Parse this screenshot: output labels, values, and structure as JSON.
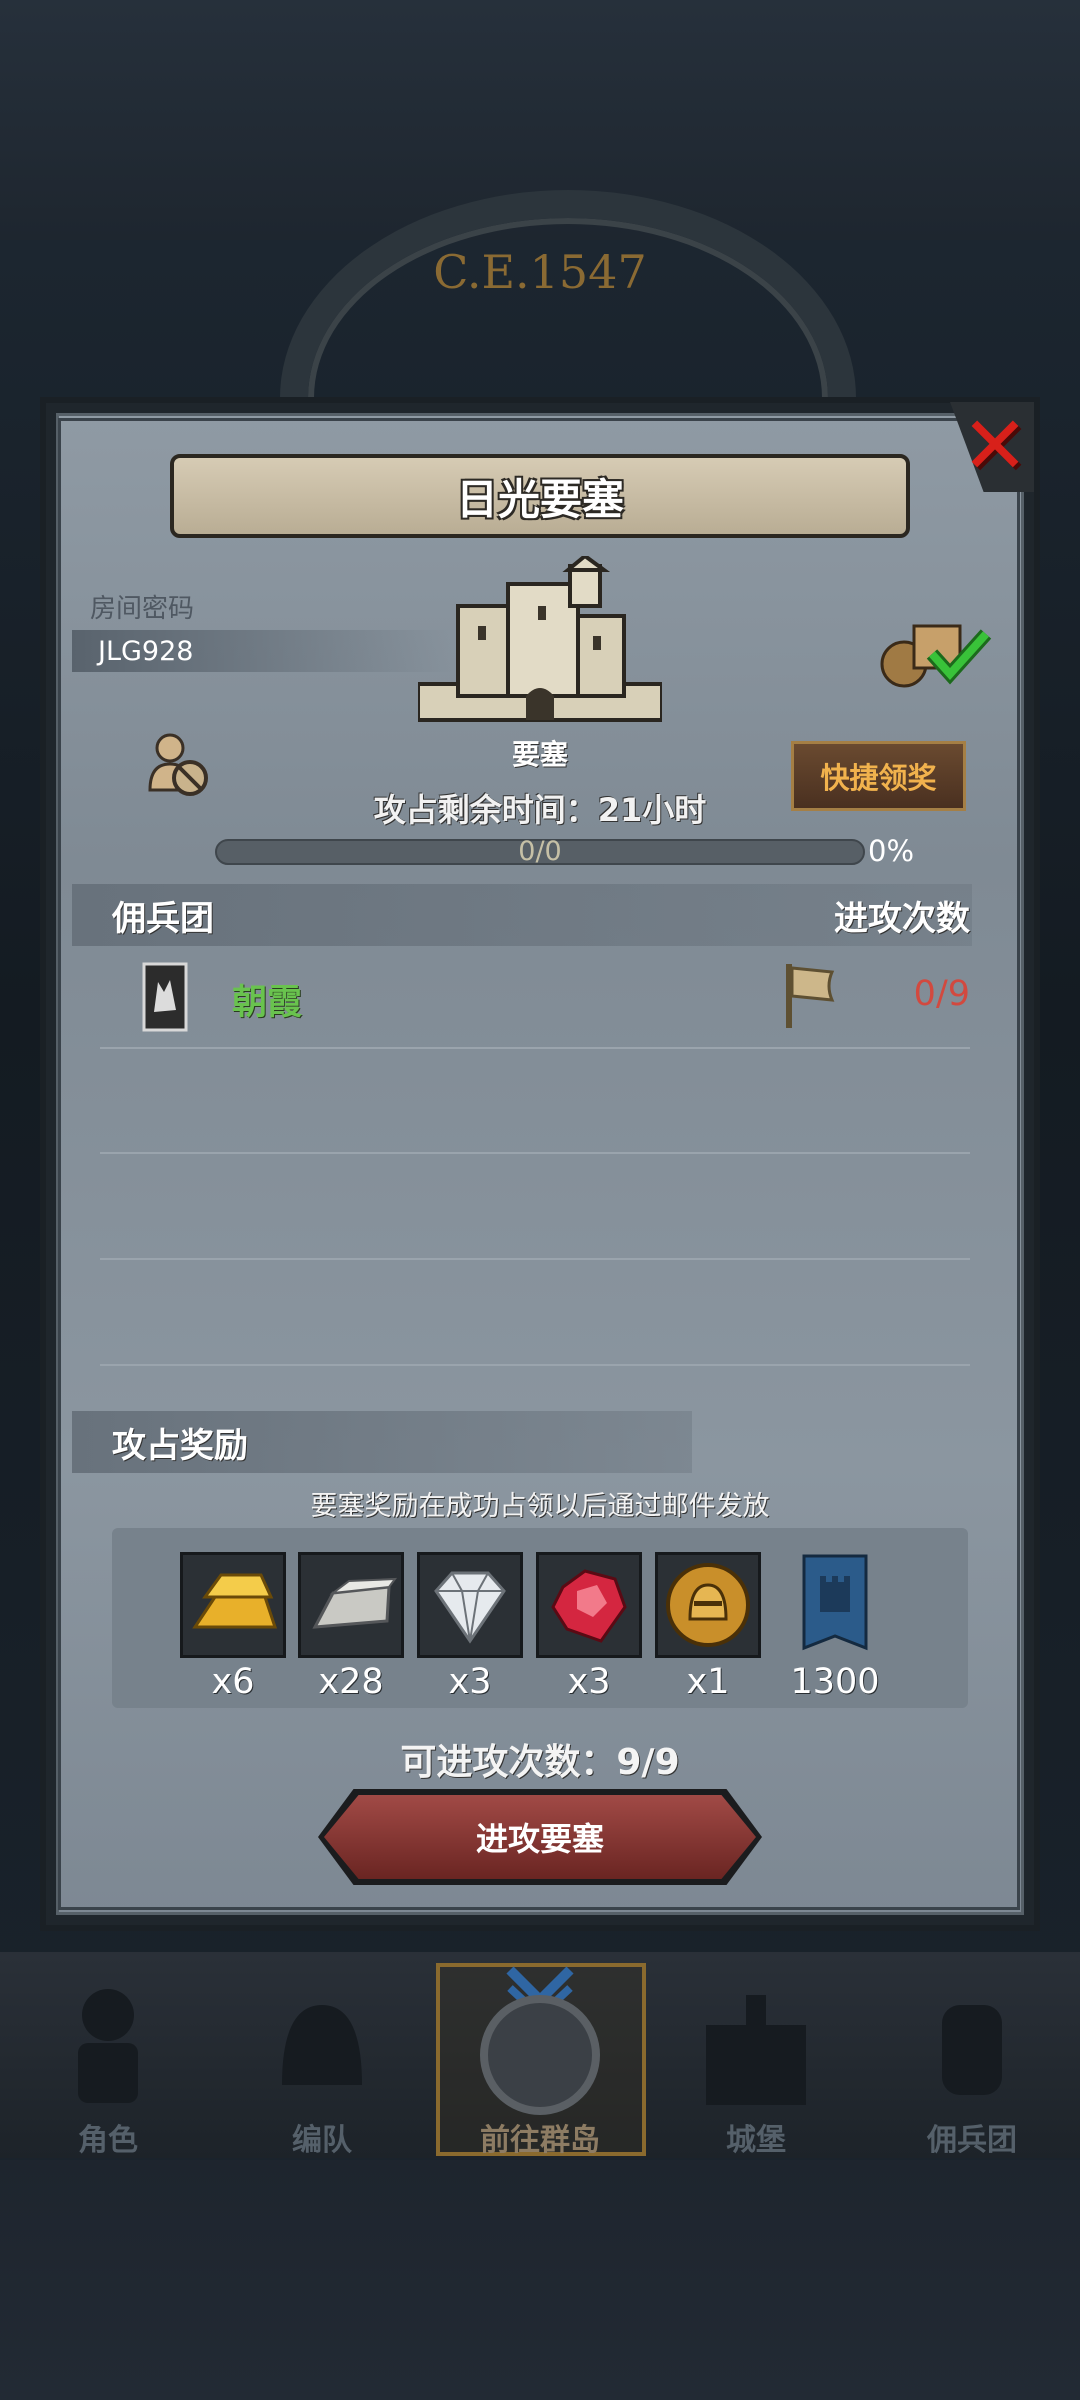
{
  "background": {
    "year": "C.E.1547"
  },
  "modal": {
    "title": "日光要塞",
    "room_code_label": "房间密码",
    "room_code": "JLG928",
    "building_name": "要塞",
    "time_remaining": "攻占剩余时间：21小时",
    "progress": {
      "text": "0/0",
      "percent_text": "0%",
      "fraction": 0.0
    },
    "quick_claim_label": "快捷领奖",
    "mercenary_section": {
      "title": "佣兵团",
      "attack_count_header": "进攻次数",
      "rows": [
        {
          "name": "朝霞",
          "count": "0/9"
        }
      ]
    },
    "reward_section": {
      "title": "攻占奖励",
      "note": "要塞奖励在成功占领以后通过邮件发放",
      "items": [
        {
          "icon": "gold-bar-icon",
          "qty": "x6"
        },
        {
          "icon": "iron-ingot-icon",
          "qty": "x28"
        },
        {
          "icon": "diamond-icon",
          "qty": "x3"
        },
        {
          "icon": "ruby-icon",
          "qty": "x3"
        },
        {
          "icon": "knight-medal-icon",
          "qty": "x1"
        },
        {
          "icon": "castle-banner-icon",
          "qty": "1300"
        }
      ]
    },
    "attempts_label": "可进攻次数：9/9",
    "attack_button": "进攻要塞"
  },
  "nav": {
    "items": [
      {
        "label": "角色",
        "icon": "knight-icon"
      },
      {
        "label": "编队",
        "icon": "helmet-icon"
      },
      {
        "label": "前往群岛",
        "icon": "globe-icon"
      },
      {
        "label": "城堡",
        "icon": "castle-icon"
      },
      {
        "label": "佣兵团",
        "icon": "fist-icon"
      }
    ],
    "active_index": 2
  },
  "colors": {
    "accent_gold": "#c8a24e",
    "mercenary_green": "#69c34e",
    "count_red": "#d2493f",
    "close_red": "#d8201a"
  }
}
